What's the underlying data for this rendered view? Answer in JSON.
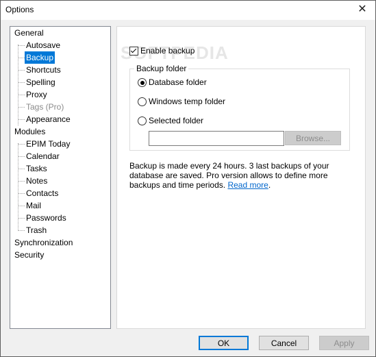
{
  "window": {
    "title": "Options",
    "close_glyph": "✕"
  },
  "tree": {
    "items": [
      {
        "label": "General",
        "level": 1
      },
      {
        "label": "Autosave",
        "level": 2
      },
      {
        "label": "Backup",
        "level": 2,
        "selected": true
      },
      {
        "label": "Shortcuts",
        "level": 2
      },
      {
        "label": "Spelling",
        "level": 2
      },
      {
        "label": "Proxy",
        "level": 2
      },
      {
        "label": "Tags (Pro)",
        "level": 2,
        "disabled": true
      },
      {
        "label": "Appearance",
        "level": 2
      },
      {
        "label": "Modules",
        "level": 1
      },
      {
        "label": "EPIM Today",
        "level": 2
      },
      {
        "label": "Calendar",
        "level": 2
      },
      {
        "label": "Tasks",
        "level": 2
      },
      {
        "label": "Notes",
        "level": 2
      },
      {
        "label": "Contacts",
        "level": 2
      },
      {
        "label": "Mail",
        "level": 2
      },
      {
        "label": "Passwords",
        "level": 2
      },
      {
        "label": "Trash",
        "level": 2
      },
      {
        "label": "Synchronization",
        "level": 1
      },
      {
        "label": "Security",
        "level": 1
      }
    ]
  },
  "backup": {
    "enable_label": "Enable backup",
    "enable_checked": true,
    "folder_group_title": "Backup folder",
    "radios": [
      {
        "label": "Database folder",
        "checked": true
      },
      {
        "label": "Windows temp folder",
        "checked": false
      },
      {
        "label": "Selected folder",
        "checked": false
      }
    ],
    "folder_value": "",
    "browse_label": "Browse...",
    "description": "Backup is made every 24 hours. 3 last backups of your database are saved. Pro version allows to define more backups and time periods.",
    "read_more_label": "Read more",
    "read_more_suffix": "."
  },
  "footer": {
    "ok_label": "OK",
    "cancel_label": "Cancel",
    "apply_label": "Apply"
  },
  "watermark": "SOFTPEDIA",
  "colors": {
    "selection": "#0078d7",
    "link": "#0066cc"
  }
}
